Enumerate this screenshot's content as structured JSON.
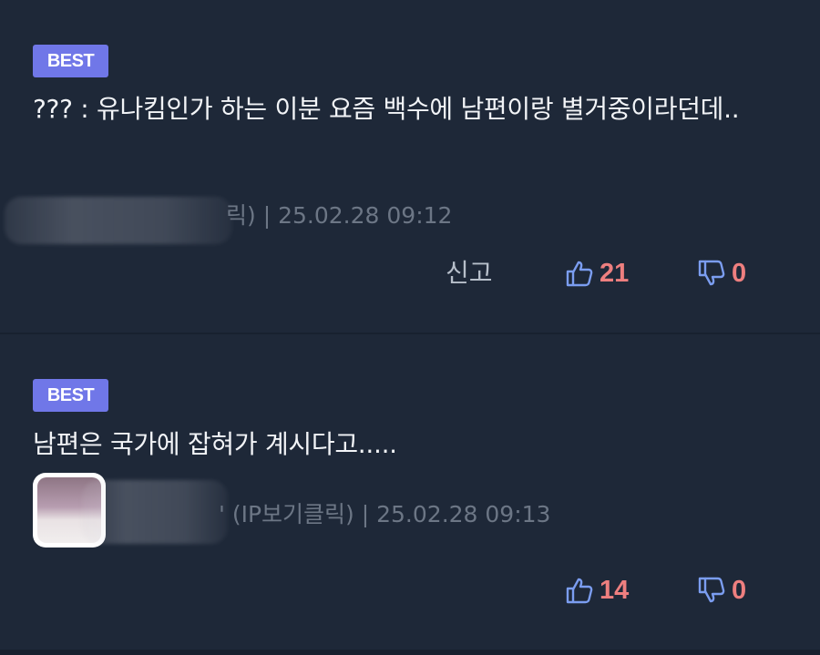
{
  "colors": {
    "background": "#1e2838",
    "badge": "#7077e8",
    "like_icon": "#7b9df0",
    "dislike_icon": "#7b9df0",
    "count": "#ee7f7f",
    "meta": "#6c7685"
  },
  "comments": [
    {
      "badge": "BEST",
      "text": "??? : 유나킴인가 하는 이분 요즘 백수에 남편이랑 별거중이라던데..",
      "author_tail": "릭)",
      "separator": "|",
      "timestamp": "25.02.28 09:12",
      "report_label": "신고",
      "likes": "21",
      "dislikes": "0",
      "like_icon": "thumbs-up-icon",
      "dislike_icon": "thumbs-down-icon"
    },
    {
      "badge": "BEST",
      "text": "남편은 국가에 잡혀가 계시다고.....",
      "author_tail": "' (IP보기클릭)",
      "separator": "|",
      "timestamp": "25.02.28 09:13",
      "likes": "14",
      "dislikes": "0",
      "like_icon": "thumbs-up-icon",
      "dislike_icon": "thumbs-down-icon"
    }
  ]
}
